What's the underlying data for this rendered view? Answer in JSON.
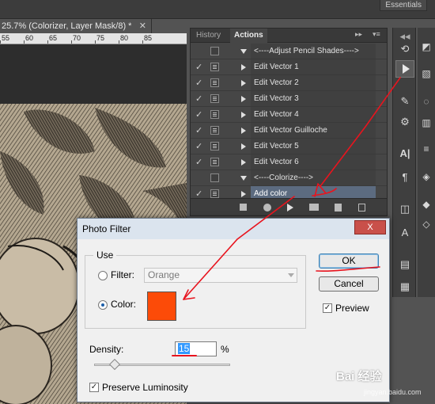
{
  "app": {
    "workspace_label": "Essentials",
    "document_tab": "25.7% (Colorizer, Layer Mask/8) *",
    "ruler_ticks": [
      "55",
      "60",
      "65",
      "70",
      "75",
      "80",
      "85"
    ]
  },
  "actions_panel": {
    "tabs": [
      "History",
      "Actions"
    ],
    "active_tab": "Actions",
    "rows": [
      {
        "label": "<----Adjust Pencil Shades---->",
        "checked": false,
        "dialog": false,
        "expanded": true,
        "selected": false
      },
      {
        "label": "Edit Vector 1",
        "checked": true,
        "dialog": true,
        "expanded": false,
        "selected": false
      },
      {
        "label": "Edit Vector 2",
        "checked": true,
        "dialog": true,
        "expanded": false,
        "selected": false
      },
      {
        "label": "Edit Vector 3",
        "checked": true,
        "dialog": true,
        "expanded": false,
        "selected": false
      },
      {
        "label": "Edit Vector 4",
        "checked": true,
        "dialog": true,
        "expanded": false,
        "selected": false
      },
      {
        "label": "Edit Vector Guilloche",
        "checked": true,
        "dialog": true,
        "expanded": false,
        "selected": false
      },
      {
        "label": "Edit Vector 5",
        "checked": true,
        "dialog": true,
        "expanded": false,
        "selected": false
      },
      {
        "label": "Edit Vector 6",
        "checked": true,
        "dialog": true,
        "expanded": false,
        "selected": false
      },
      {
        "label": "<----Colorize---->",
        "checked": false,
        "dialog": false,
        "expanded": true,
        "selected": false
      },
      {
        "label": "Add color",
        "checked": true,
        "dialog": true,
        "expanded": false,
        "selected": true
      }
    ],
    "footer_icons": [
      "stop-icon",
      "record-icon",
      "play-icon",
      "new-set-icon",
      "new-action-icon",
      "trash-icon"
    ]
  },
  "dialog": {
    "title": "Photo Filter",
    "close_symbol": "X",
    "use_label": "Use",
    "filter_label": "Filter:",
    "filter_value": "Orange",
    "color_label": "Color:",
    "selected_option": "color",
    "color_swatch": "#fc4b08",
    "density_label": "Density:",
    "density_value": "15",
    "density_unit": "%",
    "density_fraction": 0.15,
    "ok_label": "OK",
    "cancel_label": "Cancel",
    "preview_label": "Preview",
    "preview_checked": true,
    "preserve_label": "Preserve Luminosity",
    "preserve_checked": true
  },
  "colors": {
    "annotation_red": "#e8141e",
    "panel_bg": "#464646",
    "selection_blue": "#5c6b80"
  },
  "watermark": {
    "main": "Bai 经验",
    "sub": "jingyan.baidu.com"
  }
}
